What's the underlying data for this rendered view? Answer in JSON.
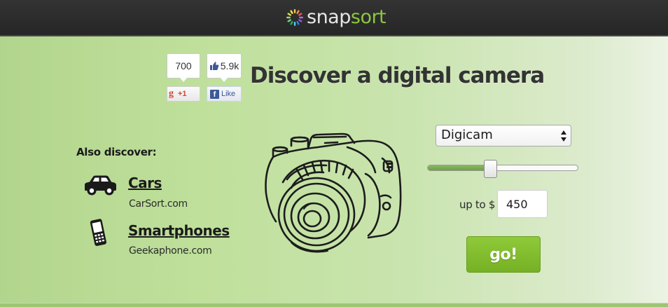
{
  "brand": {
    "name_part1": "snap",
    "name_part2": "sort",
    "icon": "snapsort-logo-icon",
    "colors": {
      "accent": "#8cc63f",
      "topbar": "#2e2e2e",
      "button": "#7fbb2c"
    }
  },
  "social": {
    "gplus": {
      "count": "700",
      "label": "+1",
      "icon": "google-plus-icon"
    },
    "facebook": {
      "count": "5.9k",
      "label": "Like",
      "icons": [
        "thumbs-up-icon",
        "facebook-icon"
      ]
    }
  },
  "headline": "Discover a digital camera",
  "also_discover": {
    "heading": "Also discover:",
    "items": [
      {
        "title": "Cars",
        "site": "CarSort.com",
        "icon": "car-icon"
      },
      {
        "title": "Smartphones",
        "site": "Geekaphone.com",
        "icon": "phone-icon"
      }
    ]
  },
  "illustration": {
    "icon": "camera-icon"
  },
  "finder": {
    "camera_type": {
      "selected": "Digicam"
    },
    "budget_slider": {
      "fraction": 0.42
    },
    "price_prefix": "up to $",
    "price_value": "450",
    "go_label": "go!"
  }
}
